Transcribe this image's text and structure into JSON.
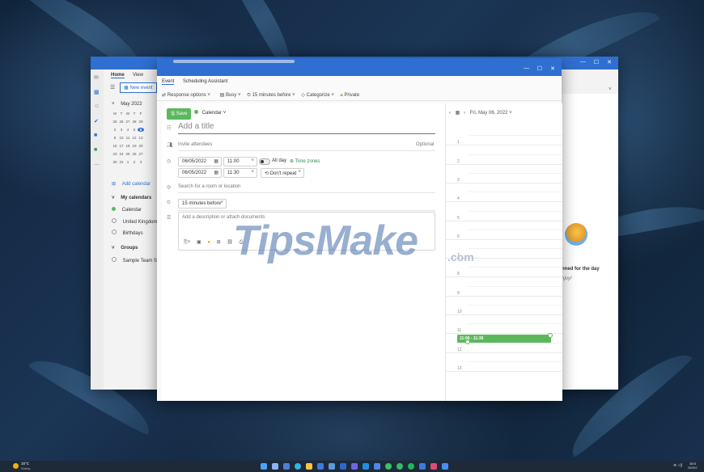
{
  "main_window": {
    "tabs": [
      "Home",
      "View"
    ],
    "new_event_label": "New event",
    "mini_calendar": {
      "month_label": "May 2022",
      "weekdays": [
        "M",
        "T",
        "W",
        "T",
        "F"
      ],
      "weeks": [
        [
          "25",
          "26",
          "27",
          "28",
          "29"
        ],
        [
          "2",
          "3",
          "4",
          "5",
          "6"
        ],
        [
          "9",
          "10",
          "11",
          "12",
          "13"
        ],
        [
          "16",
          "17",
          "18",
          "19",
          "20"
        ],
        [
          "23",
          "24",
          "25",
          "26",
          "27"
        ],
        [
          "30",
          "31",
          "1",
          "2",
          "3"
        ]
      ],
      "selected_day": "6"
    },
    "add_calendar_label": "Add calendar",
    "my_calendars_label": "My calendars",
    "calendars": [
      "Calendar",
      "United Kingdom h",
      "Birthdays"
    ],
    "groups_label": "Groups",
    "groups": [
      "Sample Team Site"
    ],
    "planned_text": "nned for the day",
    "enjoy_text": "njoy!"
  },
  "event_window": {
    "tabs": [
      "Event",
      "Scheduling Assistant"
    ],
    "toolbar": {
      "response_options": "Response options",
      "busy": "Busy",
      "reminder": "15 minutes before",
      "categorize": "Categorize",
      "private": "Private"
    },
    "save_label": "Save",
    "calendar_label": "Calendar",
    "title_placeholder": "Add a title",
    "attendees_placeholder": "Invite attendees",
    "optional_label": "Optional",
    "start_date": "06/05/2022",
    "start_time": "11:00",
    "all_day_label": "All day",
    "time_zones_label": "Time zones",
    "end_date": "06/05/2022",
    "end_time": "11:30",
    "repeat_label": "Don't repeat",
    "location_placeholder": "Search for a room or location",
    "reminder_value": "15 minutes before",
    "description_placeholder": "Add a description or attach documents",
    "day_view": {
      "date_label": "Fri, May 06, 2022",
      "hours": [
        "1",
        "2",
        "3",
        "4",
        "5",
        "6",
        "7",
        "8",
        "9",
        "10",
        "11",
        "12",
        "13"
      ],
      "event_block": "11:00 - 11:30"
    }
  },
  "watermark": {
    "main": "TipsMake",
    "suffix": ".com"
  },
  "taskbar": {
    "weather_temp": "15°C",
    "weather_desc": "Sunny",
    "clock_time": "10:3",
    "clock_date": "06/05/2"
  },
  "colors": {
    "accent": "#2f6fd1",
    "save_green": "#5cb85c",
    "event_green": "#5cb85c"
  }
}
